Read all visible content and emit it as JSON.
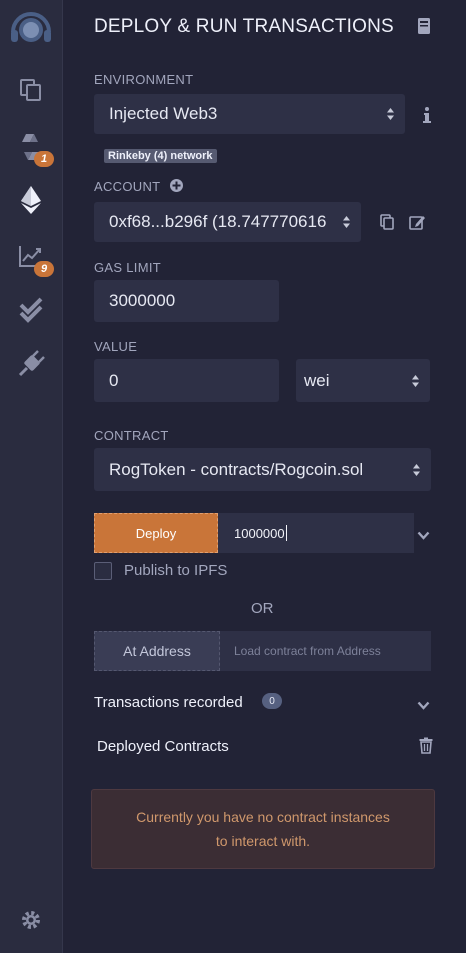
{
  "sidebar": {
    "badges": {
      "deploy": "1",
      "analysis": "9"
    }
  },
  "panel": {
    "title": "DEPLOY & RUN TRANSACTIONS",
    "environment": {
      "label": "ENVIRONMENT",
      "value": "Injected Web3",
      "network_tag": "Rinkeby (4) network"
    },
    "account": {
      "label": "ACCOUNT",
      "value": "0xf68...b296f (18.747770616"
    },
    "gas_limit": {
      "label": "GAS LIMIT",
      "value": "3000000"
    },
    "value": {
      "label": "VALUE",
      "amount": "0",
      "unit": "wei"
    },
    "contract": {
      "label": "CONTRACT",
      "value": "RogToken - contracts/Rogcoin.sol"
    },
    "deploy": {
      "button_label": "Deploy",
      "args": "1000000"
    },
    "publish": {
      "label": "Publish to IPFS",
      "checked": false
    },
    "or_label": "OR",
    "at_address": {
      "button_label": "At Address",
      "placeholder": "Load contract from Address"
    },
    "transactions": {
      "label": "Transactions recorded",
      "count": "0"
    },
    "deployed": {
      "label": "Deployed Contracts"
    },
    "empty_message": "Currently you have no contract instances to interact with."
  },
  "colors": {
    "accent": "#c97539",
    "panel_bg": "#222336",
    "field_bg": "#2e3046",
    "alert_bg": "#3b2d34"
  }
}
